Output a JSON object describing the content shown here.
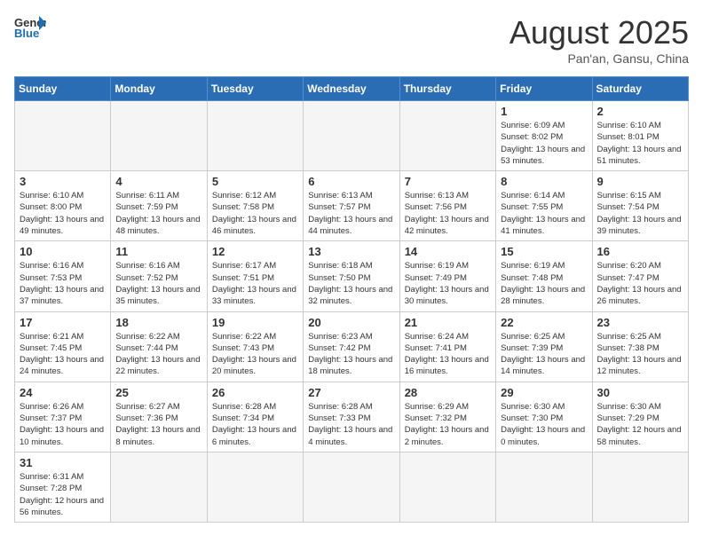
{
  "header": {
    "logo_general": "General",
    "logo_blue": "Blue",
    "month_title": "August 2025",
    "subtitle": "Pan'an, Gansu, China"
  },
  "days_of_week": [
    "Sunday",
    "Monday",
    "Tuesday",
    "Wednesday",
    "Thursday",
    "Friday",
    "Saturday"
  ],
  "weeks": [
    [
      {
        "day": "",
        "info": ""
      },
      {
        "day": "",
        "info": ""
      },
      {
        "day": "",
        "info": ""
      },
      {
        "day": "",
        "info": ""
      },
      {
        "day": "",
        "info": ""
      },
      {
        "day": "1",
        "info": "Sunrise: 6:09 AM\nSunset: 8:02 PM\nDaylight: 13 hours and 53 minutes."
      },
      {
        "day": "2",
        "info": "Sunrise: 6:10 AM\nSunset: 8:01 PM\nDaylight: 13 hours and 51 minutes."
      }
    ],
    [
      {
        "day": "3",
        "info": "Sunrise: 6:10 AM\nSunset: 8:00 PM\nDaylight: 13 hours and 49 minutes."
      },
      {
        "day": "4",
        "info": "Sunrise: 6:11 AM\nSunset: 7:59 PM\nDaylight: 13 hours and 48 minutes."
      },
      {
        "day": "5",
        "info": "Sunrise: 6:12 AM\nSunset: 7:58 PM\nDaylight: 13 hours and 46 minutes."
      },
      {
        "day": "6",
        "info": "Sunrise: 6:13 AM\nSunset: 7:57 PM\nDaylight: 13 hours and 44 minutes."
      },
      {
        "day": "7",
        "info": "Sunrise: 6:13 AM\nSunset: 7:56 PM\nDaylight: 13 hours and 42 minutes."
      },
      {
        "day": "8",
        "info": "Sunrise: 6:14 AM\nSunset: 7:55 PM\nDaylight: 13 hours and 41 minutes."
      },
      {
        "day": "9",
        "info": "Sunrise: 6:15 AM\nSunset: 7:54 PM\nDaylight: 13 hours and 39 minutes."
      }
    ],
    [
      {
        "day": "10",
        "info": "Sunrise: 6:16 AM\nSunset: 7:53 PM\nDaylight: 13 hours and 37 minutes."
      },
      {
        "day": "11",
        "info": "Sunrise: 6:16 AM\nSunset: 7:52 PM\nDaylight: 13 hours and 35 minutes."
      },
      {
        "day": "12",
        "info": "Sunrise: 6:17 AM\nSunset: 7:51 PM\nDaylight: 13 hours and 33 minutes."
      },
      {
        "day": "13",
        "info": "Sunrise: 6:18 AM\nSunset: 7:50 PM\nDaylight: 13 hours and 32 minutes."
      },
      {
        "day": "14",
        "info": "Sunrise: 6:19 AM\nSunset: 7:49 PM\nDaylight: 13 hours and 30 minutes."
      },
      {
        "day": "15",
        "info": "Sunrise: 6:19 AM\nSunset: 7:48 PM\nDaylight: 13 hours and 28 minutes."
      },
      {
        "day": "16",
        "info": "Sunrise: 6:20 AM\nSunset: 7:47 PM\nDaylight: 13 hours and 26 minutes."
      }
    ],
    [
      {
        "day": "17",
        "info": "Sunrise: 6:21 AM\nSunset: 7:45 PM\nDaylight: 13 hours and 24 minutes."
      },
      {
        "day": "18",
        "info": "Sunrise: 6:22 AM\nSunset: 7:44 PM\nDaylight: 13 hours and 22 minutes."
      },
      {
        "day": "19",
        "info": "Sunrise: 6:22 AM\nSunset: 7:43 PM\nDaylight: 13 hours and 20 minutes."
      },
      {
        "day": "20",
        "info": "Sunrise: 6:23 AM\nSunset: 7:42 PM\nDaylight: 13 hours and 18 minutes."
      },
      {
        "day": "21",
        "info": "Sunrise: 6:24 AM\nSunset: 7:41 PM\nDaylight: 13 hours and 16 minutes."
      },
      {
        "day": "22",
        "info": "Sunrise: 6:25 AM\nSunset: 7:39 PM\nDaylight: 13 hours and 14 minutes."
      },
      {
        "day": "23",
        "info": "Sunrise: 6:25 AM\nSunset: 7:38 PM\nDaylight: 13 hours and 12 minutes."
      }
    ],
    [
      {
        "day": "24",
        "info": "Sunrise: 6:26 AM\nSunset: 7:37 PM\nDaylight: 13 hours and 10 minutes."
      },
      {
        "day": "25",
        "info": "Sunrise: 6:27 AM\nSunset: 7:36 PM\nDaylight: 13 hours and 8 minutes."
      },
      {
        "day": "26",
        "info": "Sunrise: 6:28 AM\nSunset: 7:34 PM\nDaylight: 13 hours and 6 minutes."
      },
      {
        "day": "27",
        "info": "Sunrise: 6:28 AM\nSunset: 7:33 PM\nDaylight: 13 hours and 4 minutes."
      },
      {
        "day": "28",
        "info": "Sunrise: 6:29 AM\nSunset: 7:32 PM\nDaylight: 13 hours and 2 minutes."
      },
      {
        "day": "29",
        "info": "Sunrise: 6:30 AM\nSunset: 7:30 PM\nDaylight: 13 hours and 0 minutes."
      },
      {
        "day": "30",
        "info": "Sunrise: 6:30 AM\nSunset: 7:29 PM\nDaylight: 12 hours and 58 minutes."
      }
    ],
    [
      {
        "day": "31",
        "info": "Sunrise: 6:31 AM\nSunset: 7:28 PM\nDaylight: 12 hours and 56 minutes."
      },
      {
        "day": "",
        "info": ""
      },
      {
        "day": "",
        "info": ""
      },
      {
        "day": "",
        "info": ""
      },
      {
        "day": "",
        "info": ""
      },
      {
        "day": "",
        "info": ""
      },
      {
        "day": "",
        "info": ""
      }
    ]
  ]
}
